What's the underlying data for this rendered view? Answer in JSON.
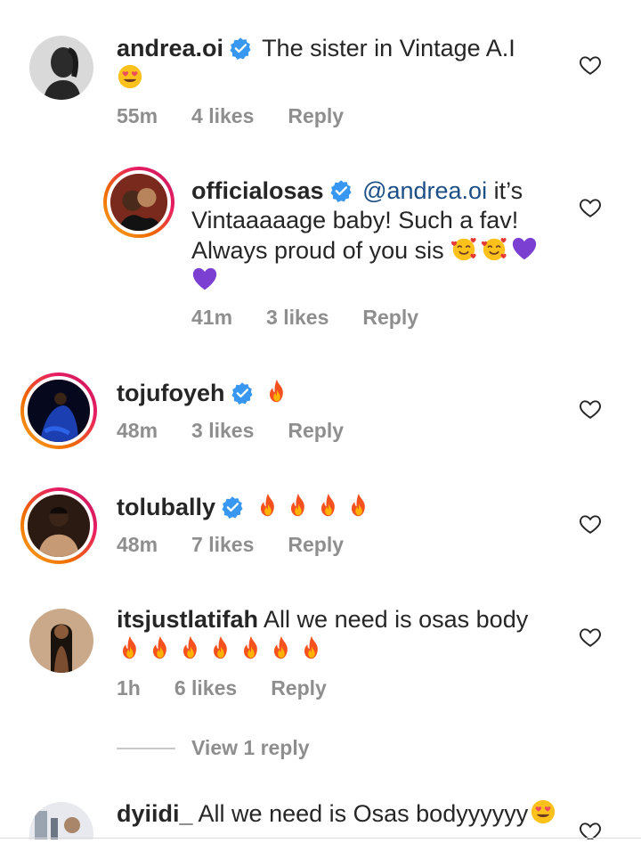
{
  "colors": {
    "text": "#262626",
    "muted": "#8e8e8e",
    "verified": "#3897f0",
    "mention": "#1c4f86"
  },
  "comments": [
    {
      "username": "andrea.oi",
      "verified": true,
      "text": "The sister in Vintage A.I",
      "emojis": [
        "heart-eyes-emoji"
      ],
      "time": "55m",
      "likes": "4 likes",
      "reply": "Reply"
    },
    {
      "username": "officialosas",
      "verified": true,
      "mention": "@andrea.oi",
      "text_line1": "it’s",
      "text_line2": "Vintaaaaage baby! Such a fav!",
      "text_line3": "Always proud of you sis",
      "emojis": [
        "smiling-hearts-emoji",
        "smiling-hearts-emoji",
        "purple-heart-emoji",
        "purple-heart-emoji"
      ],
      "time": "41m",
      "likes": "3 likes",
      "reply": "Reply"
    },
    {
      "username": "tojufoyeh",
      "verified": true,
      "emojis": [
        "fire-emoji"
      ],
      "time": "48m",
      "likes": "3 likes",
      "reply": "Reply"
    },
    {
      "username": "tolubally",
      "verified": true,
      "emojis": [
        "fire-emoji",
        "fire-emoji",
        "fire-emoji",
        "fire-emoji"
      ],
      "time": "48m",
      "likes": "7 likes",
      "reply": "Reply"
    },
    {
      "username": "itsjustlatifah",
      "verified": false,
      "text": "All we need is osas body",
      "emojis": [
        "fire-emoji",
        "fire-emoji",
        "fire-emoji",
        "fire-emoji",
        "fire-emoji",
        "fire-emoji",
        "fire-emoji"
      ],
      "time": "1h",
      "likes": "6 likes",
      "reply": "Reply"
    },
    {
      "username": "dyiidi_",
      "verified": false,
      "text": "All we need is Osas bodyyyyyy",
      "emojis": [
        "heart-eyes-emoji"
      ]
    }
  ],
  "view_replies": "View 1 reply"
}
